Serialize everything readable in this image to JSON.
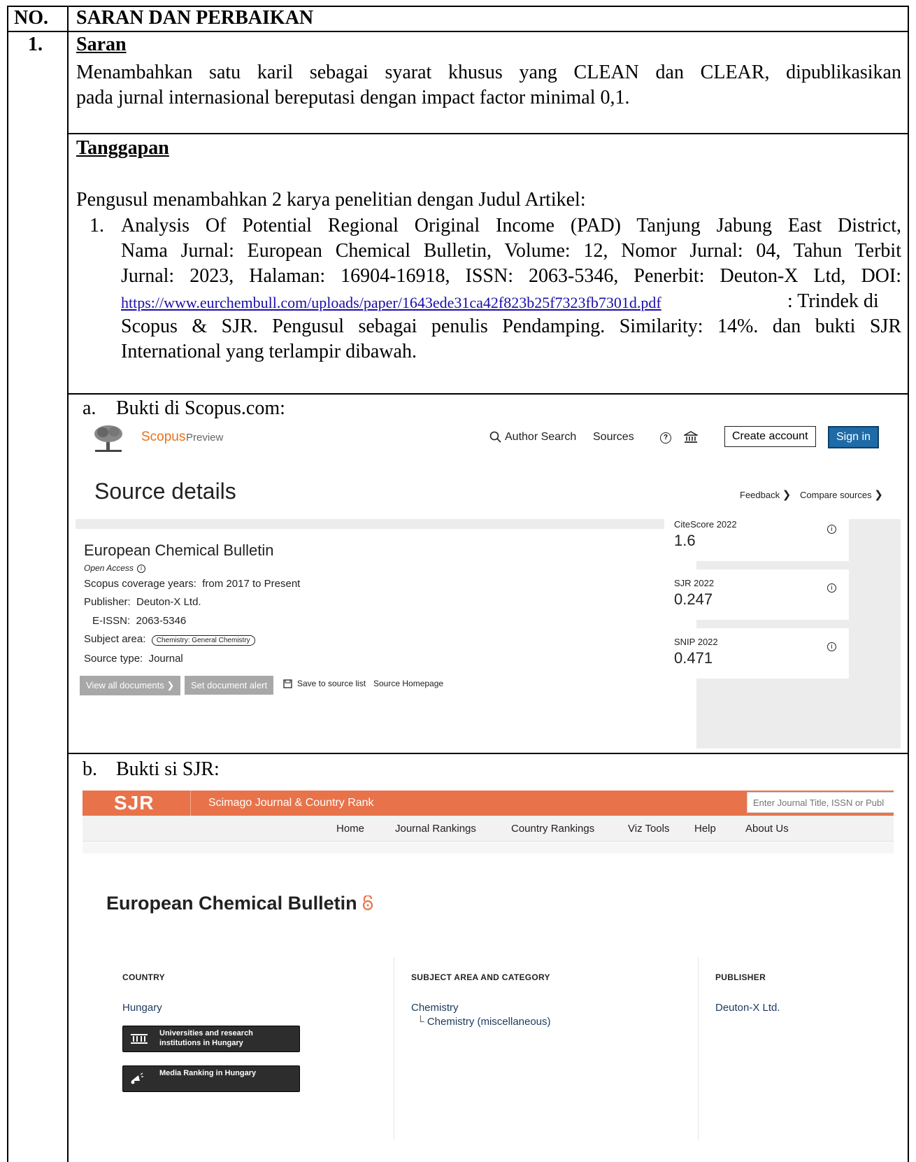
{
  "table": {
    "header_no": "NO.",
    "header_title": "SARAN DAN PERBAIKAN",
    "row_no": "1."
  },
  "saran": {
    "heading": "Saran",
    "line1": "Menambahkan satu karil sebagai syarat khusus yang CLEAN dan CLEAR, dipublikasikan",
    "line2": "pada jurnal internasional bereputasi dengan impact factor minimal 0,1."
  },
  "tanggapan": {
    "heading": "Tanggapan",
    "intro": "Pengusul menambahkan 2 karya penelitian dengan Judul Artikel:",
    "item_no": "1.",
    "lines": [
      "Analysis Of Potential Regional Original Income (PAD) Tanjung Jabung East District,",
      "Nama Jurnal: European Chemical Bulletin, Volume: 12, Nomor Jurnal: 04, Tahun Terbit",
      "Jurnal: 2023, Halaman: 16904-16918, ISSN: 2063-5346, Penerbit: Deuton-X Ltd, DOI:"
    ],
    "doi_link": "https://www.eurchembull.com/uploads/paper/1643ede31ca42f823b25f7323fb7301d.pdf",
    "after_link": ": Trindek di",
    "line5": "Scopus & SJR. Pengusul sebagai penulis Pendamping. Similarity: 14%. dan bukti SJR",
    "line6": "International yang terlampir dibawah."
  },
  "proof_a": {
    "label": "a.",
    "text": "Bukti di Scopus.com:"
  },
  "scopus": {
    "brand": "Scopus",
    "brand_sub": "Preview",
    "nav": {
      "author_search": "Author Search",
      "sources": "Sources",
      "create_account": "Create account",
      "sign_in": "Sign in"
    },
    "page_title": "Source details",
    "feedback": "Feedback",
    "compare": "Compare sources",
    "journal_title": "European Chemical Bulletin",
    "open_access": "Open Access",
    "coverage_label": "Scopus coverage years:",
    "coverage_value": "from 2017 to Present",
    "publisher_label": "Publisher:",
    "publisher_value": "Deuton-X Ltd.",
    "eissn_label": "E-ISSN:",
    "eissn_value": "2063-5346",
    "subject_label": "Subject area:",
    "subject_value": "Chemistry: General Chemistry",
    "source_type_label": "Source type:",
    "source_type_value": "Journal",
    "btn_view_all": "View all documents",
    "btn_alert": "Set document alert",
    "save_list": "Save to source list",
    "homepage": "Source Homepage",
    "metrics": [
      {
        "label": "CiteScore 2022",
        "value": "1.6"
      },
      {
        "label": "SJR 2022",
        "value": "0.247"
      },
      {
        "label": "SNIP 2022",
        "value": "0.471"
      }
    ]
  },
  "proof_b": {
    "label": "b.",
    "text": "Bukti si SJR:"
  },
  "sjr": {
    "logo": "SJR",
    "site_name": "Scimago Journal & Country Rank",
    "search_placeholder": "Enter Journal Title, ISSN or Publ",
    "menu": [
      "Home",
      "Journal Rankings",
      "Country Rankings",
      "Viz Tools",
      "Help",
      "About Us"
    ],
    "journal_title": "European Chemical Bulletin",
    "country_head": "COUNTRY",
    "country_value": "Hungary",
    "btn_universities_1": "Universities and research",
    "btn_universities_2": "institutions in Hungary",
    "btn_media": "Media Ranking in Hungary",
    "subject_head": "SUBJECT AREA AND CATEGORY",
    "subject_value": "Chemistry",
    "subject_sub": "Chemistry (miscellaneous)",
    "publisher_head": "PUBLISHER",
    "publisher_value": "Deuton-X Ltd."
  },
  "colors": {
    "sjr_orange": "#e8734a",
    "scopus_blue": "#1f6ba8",
    "scopus_orange": "#e9711c"
  }
}
